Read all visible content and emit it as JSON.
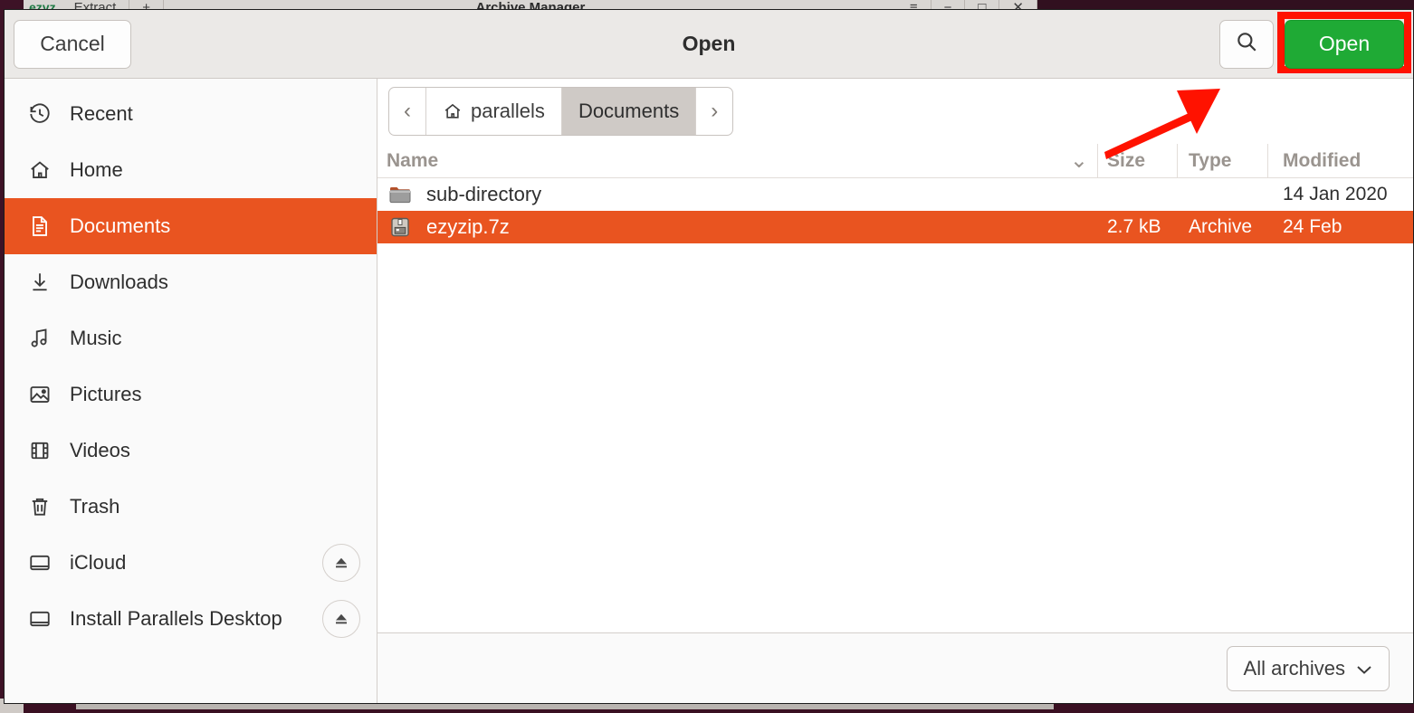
{
  "background_window": {
    "title": "Archive Manager",
    "logo_text": "ezyz",
    "buttons": [
      "Extract",
      "+"
    ],
    "window_controls": [
      "≡",
      "−",
      "□",
      "✕"
    ]
  },
  "dialog": {
    "title": "Open",
    "cancel_label": "Cancel",
    "open_label": "Open",
    "search_icon": "search-icon"
  },
  "sidebar": {
    "items": [
      {
        "label": "Recent",
        "icon": "clock-history-icon",
        "selected": false,
        "eject": false
      },
      {
        "label": "Home",
        "icon": "home-icon",
        "selected": false,
        "eject": false
      },
      {
        "label": "Documents",
        "icon": "document-icon",
        "selected": true,
        "eject": false
      },
      {
        "label": "Downloads",
        "icon": "download-arrow-icon",
        "selected": false,
        "eject": false
      },
      {
        "label": "Music",
        "icon": "music-note-icon",
        "selected": false,
        "eject": false
      },
      {
        "label": "Pictures",
        "icon": "picture-icon",
        "selected": false,
        "eject": false
      },
      {
        "label": "Videos",
        "icon": "film-strip-icon",
        "selected": false,
        "eject": false
      },
      {
        "label": "Trash",
        "icon": "trash-icon",
        "selected": false,
        "eject": false
      },
      {
        "label": "iCloud",
        "icon": "drive-icon",
        "selected": false,
        "eject": true
      },
      {
        "label": "Install Parallels Desktop",
        "icon": "drive-icon",
        "selected": false,
        "eject": true
      }
    ]
  },
  "pathbar": {
    "back_label": "‹",
    "forward_label": "›",
    "crumbs": [
      {
        "label": "parallels",
        "icon": "home-icon",
        "active": false
      },
      {
        "label": "Documents",
        "icon": "",
        "active": true
      }
    ]
  },
  "file_list": {
    "columns": [
      "Name",
      "Size",
      "Type",
      "Modified"
    ],
    "sort_indicator": "⌄",
    "rows": [
      {
        "icon": "folder-icon",
        "name": "sub-directory",
        "size": "",
        "type": "",
        "modified": "14 Jan 2020",
        "selected": false
      },
      {
        "icon": "archive-file-icon",
        "name": "ezyzip.7z",
        "size": "2.7 kB",
        "type": "Archive",
        "modified": "24 Feb",
        "selected": true
      }
    ]
  },
  "footer": {
    "filter_label": "All archives",
    "filter_chevron": "⌄"
  },
  "colors": {
    "accent_orange": "#e95420",
    "open_green": "#1faa35",
    "annotation_red": "#ff1200",
    "header_bg": "#ebe9e7",
    "sidebar_bg": "#fafafa"
  },
  "annotations": {
    "arrow": "red-arrow-pointing-to-open-button",
    "highlight_box": "red-box-around-open-button"
  }
}
